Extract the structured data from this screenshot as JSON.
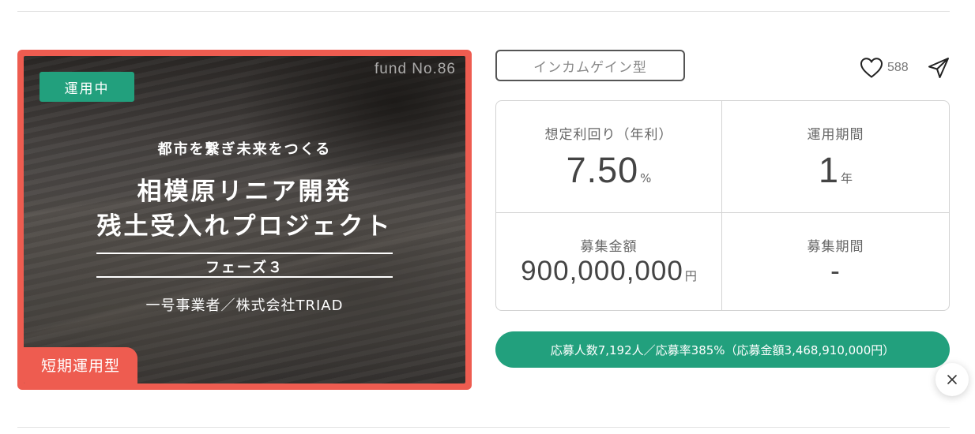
{
  "fund_card": {
    "status_badge": "運用中",
    "fund_number": "fund No.86",
    "catchphrase": "都市を繋ぎ未来をつくる",
    "title_line1": "相模原リニア開発",
    "title_line2": "残土受入れプロジェクト",
    "phase": "フェーズ３",
    "operator": "一号事業者／株式会社TRIAD",
    "category_badge": "短期運用型"
  },
  "info": {
    "type_tag": "インカムゲイン型",
    "favorite_count": "588",
    "favorite_icon": "heart-outline-icon",
    "share_icon": "paper-plane-icon"
  },
  "stats": {
    "yield": {
      "label": "想定利回り（年利）",
      "value": "7.50",
      "unit": "%"
    },
    "period": {
      "label": "運用期間",
      "value": "1",
      "unit": "年"
    },
    "amount": {
      "label": "募集金額",
      "value": "900,000,000",
      "unit": "円"
    },
    "recruit_period": {
      "label": "募集期間",
      "value": "-",
      "unit": ""
    }
  },
  "apply_summary": "応募人数7,192人／応募率385%（応募金額3,468,910,000円）",
  "close_icon": "close-icon",
  "colors": {
    "accent_green": "#22a07d",
    "accent_coral": "#ee5c50"
  }
}
